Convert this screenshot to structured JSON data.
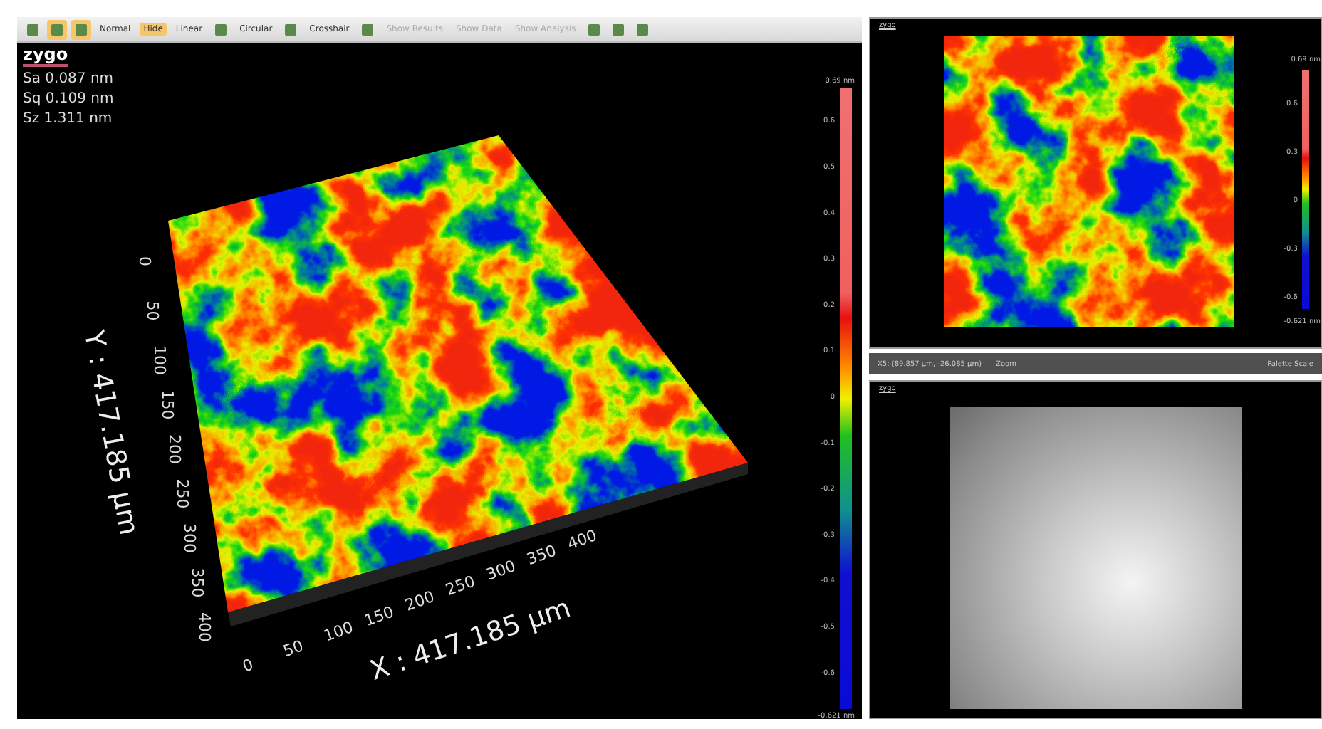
{
  "toolbar": {
    "items": [
      {
        "kind": "icon",
        "selected": false
      },
      {
        "kind": "icon",
        "selected": true
      },
      {
        "kind": "icon",
        "selected": true
      },
      {
        "kind": "text",
        "label": "Normal",
        "selected": false,
        "disabled": false
      },
      {
        "kind": "text",
        "label": "Hide",
        "selected": true,
        "disabled": false
      },
      {
        "kind": "text",
        "label": "Linear",
        "selected": false,
        "disabled": false
      },
      {
        "kind": "icon",
        "selected": false
      },
      {
        "kind": "text",
        "label": "Circular",
        "selected": false,
        "disabled": false
      },
      {
        "kind": "icon",
        "selected": false
      },
      {
        "kind": "text",
        "label": "Crosshair",
        "selected": false,
        "disabled": false
      },
      {
        "kind": "icon",
        "selected": false
      },
      {
        "kind": "text",
        "label": "Show Results",
        "selected": false,
        "disabled": true
      },
      {
        "kind": "text",
        "label": "Show Data",
        "selected": false,
        "disabled": true
      },
      {
        "kind": "text",
        "label": "Show Analysis",
        "selected": false,
        "disabled": true
      },
      {
        "kind": "icon",
        "selected": false
      },
      {
        "kind": "icon",
        "selected": false
      },
      {
        "kind": "icon",
        "selected": false
      }
    ]
  },
  "surface_view": {
    "logo": "zygo",
    "stats": [
      "Sa 0.087 nm",
      "Sq 0.109 nm",
      "Sz 1.311 nm"
    ],
    "y_axis": {
      "label": "Y : 417.185 µm",
      "ticks": [
        "0",
        "50",
        "100",
        "150",
        "200",
        "250",
        "300",
        "350",
        "400"
      ]
    },
    "x_axis": {
      "label": "X : 417.185 µm",
      "ticks": [
        "0",
        "50",
        "100",
        "150",
        "200",
        "250",
        "300",
        "350",
        "400"
      ]
    },
    "colorbar": {
      "max": "0.69 nm",
      "min": "-0.621 nm",
      "ticks": [
        "0.6",
        "0.5",
        "0.4",
        "0.3",
        "0.2",
        "0.1",
        "0",
        "-0.1",
        "-0.2",
        "-0.3",
        "-0.4",
        "-0.5",
        "-0.6"
      ]
    }
  },
  "map_view": {
    "logo": "zygo",
    "colorbar": {
      "max": "0.69 nm",
      "min": "-0.621 nm",
      "ticks": [
        "0.6",
        "0.3",
        "0",
        "-0.3",
        "-0.6"
      ]
    }
  },
  "status_bar": {
    "coordinates": "X5: (89.857 µm, -26.085 µm)",
    "mode": "Zoom",
    "palette": "Palette Scale"
  },
  "intensity_view": {
    "logo": "zygo"
  }
}
